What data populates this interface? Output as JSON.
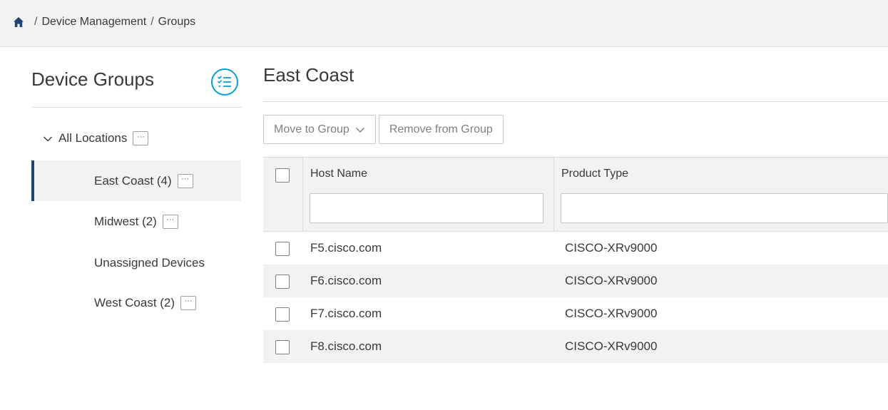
{
  "breadcrumb": {
    "items": [
      "Device Management",
      "Groups"
    ],
    "separator": "/"
  },
  "sidebar": {
    "title": "Device Groups",
    "root": {
      "label": "All Locations"
    },
    "items": [
      {
        "label": "East Coast (4)",
        "active": true
      },
      {
        "label": "Midwest (2)"
      },
      {
        "label": "Unassigned Devices"
      },
      {
        "label": "West Coast (2)"
      }
    ]
  },
  "main": {
    "title": "East Coast",
    "toolbar": {
      "move_label": "Move to Group",
      "remove_label": "Remove from Group"
    },
    "table": {
      "columns": [
        "Host Name",
        "Product Type"
      ],
      "filters": {
        "host": "",
        "product": ""
      },
      "rows": [
        {
          "host": "F5.cisco.com",
          "product": "CISCO-XRv9000"
        },
        {
          "host": "F6.cisco.com",
          "product": "CISCO-XRv9000"
        },
        {
          "host": "F7.cisco.com",
          "product": "CISCO-XRv9000"
        },
        {
          "host": "F8.cisco.com",
          "product": "CISCO-XRv9000"
        }
      ]
    }
  },
  "icons": {
    "home": "home-icon",
    "list": "checklist-icon",
    "more": "ellipsis-icon",
    "chevron": "chevron-down-icon"
  },
  "colors": {
    "accent": "#049fd9",
    "active_bar": "#1e4471",
    "home_icon": "#1e4471",
    "panel_bg": "#f2f2f2"
  }
}
